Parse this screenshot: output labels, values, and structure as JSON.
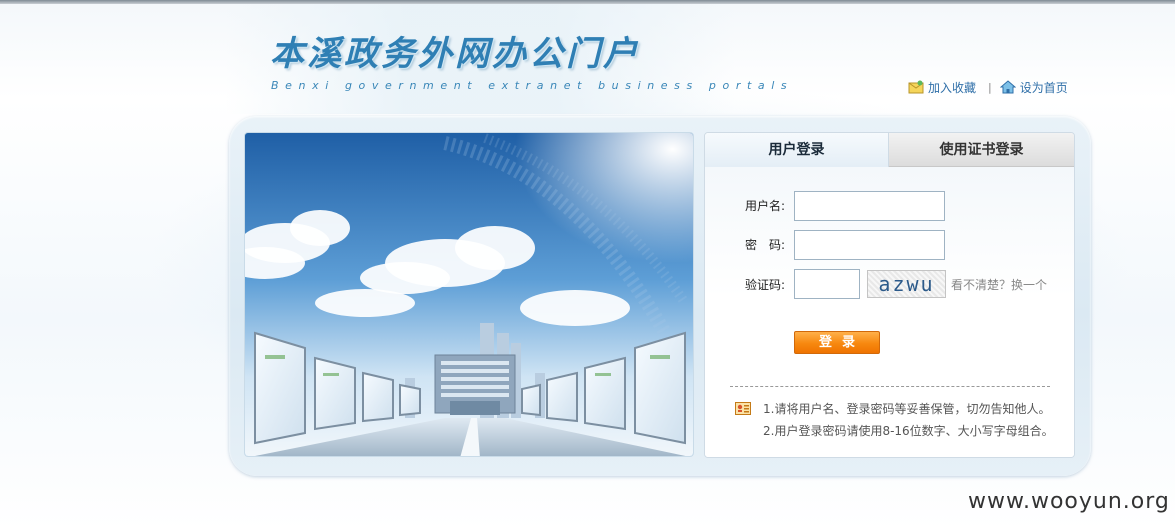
{
  "header": {
    "logo_title": "本溪政务外网办公门户",
    "logo_subtitle": "Benxi government extranet business portals",
    "links": [
      {
        "label": "加入收藏",
        "icon": "bookmark-icon"
      },
      {
        "label": "设为首页",
        "icon": "home-icon"
      }
    ],
    "separator": "|"
  },
  "login": {
    "tabs": [
      {
        "label": "用户登录",
        "active": true
      },
      {
        "label": "使用证书登录",
        "active": false
      }
    ],
    "username_label": "用户名:",
    "password_label": "密　码:",
    "captcha_label": "验证码:",
    "username_value": "",
    "password_value": "",
    "captcha_value": "",
    "captcha_image_text": "azwu",
    "captcha_help": "看不清楚？换一个",
    "submit_label": "登录",
    "notes": [
      "1.请将用户名、登录密码等妥善保管，切勿告知他人。",
      "2.用户登录密码请使用8-16位数字、大小写字母组合。"
    ]
  },
  "watermark": "www.wooyun.org",
  "colors": {
    "accent_orange": "#f7880f",
    "link_blue": "#2f6fa8",
    "logo_blue": "#2f7fb4"
  }
}
